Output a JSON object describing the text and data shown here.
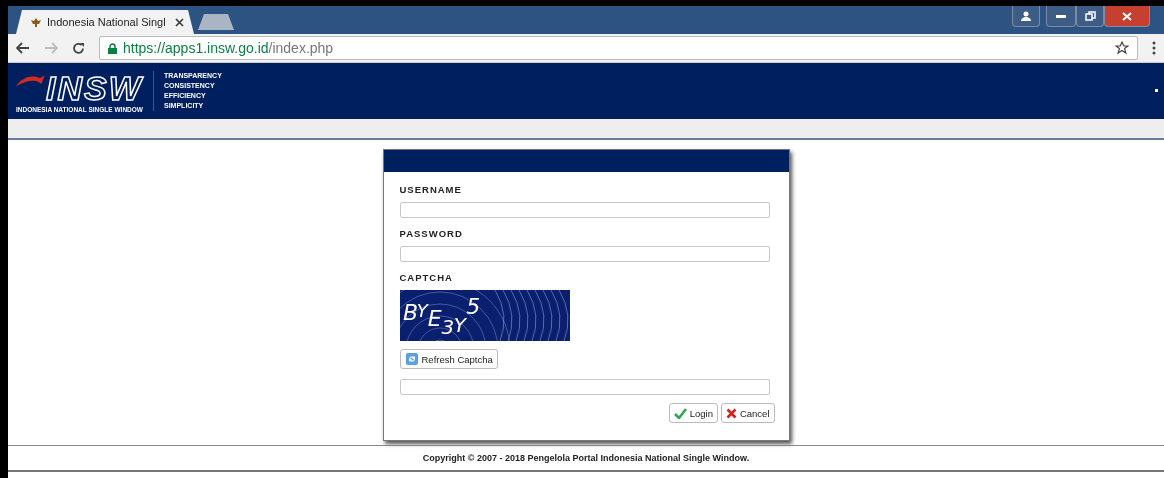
{
  "browser": {
    "tabs": [
      {
        "title": "Indonesia National Singl",
        "selected": true
      }
    ],
    "url_host": "https://apps1.insw.go.id",
    "url_path": "/index.php"
  },
  "header": {
    "logo_text": "INSW",
    "logo_caption": "INDONESIA NATIONAL SINGLE WINDOW",
    "taglines": [
      "TRANSPARENCY",
      "CONSISTENCY",
      "EFFICIENCY",
      "SIMPLICITY"
    ]
  },
  "login": {
    "fields": [
      {
        "label": "USERNAME",
        "kind": "text"
      },
      {
        "label": "PASSWORD",
        "kind": "password"
      },
      {
        "label": "CAPTCHA",
        "kind": "captcha",
        "captcha_text": "BYE3Y5"
      }
    ],
    "refresh_button": "Refresh Captcha",
    "buttons": [
      {
        "label": "Login",
        "kind": "ok"
      },
      {
        "label": "Cancel",
        "kind": "cancel"
      }
    ]
  },
  "footer": "Copyright © 2007 - 2018 Pengelola Portal Indonesia National Single Window."
}
